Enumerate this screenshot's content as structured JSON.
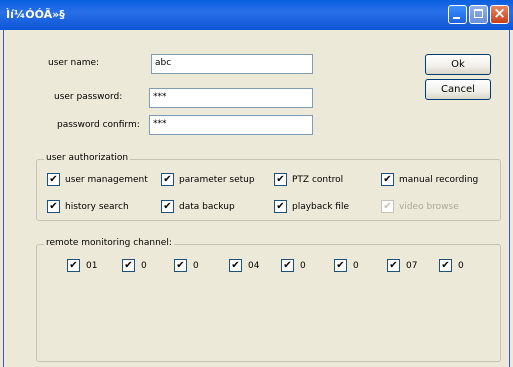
{
  "window": {
    "title": "Ìí¼ÓÓÃ»§"
  },
  "form": {
    "username_label": "user name:",
    "username_value": "abc",
    "password_label": "user password:",
    "password_value": "***",
    "confirm_label": "password confirm:",
    "confirm_value": "***"
  },
  "buttons": {
    "ok": "Ok",
    "cancel": "Cancel"
  },
  "authorization": {
    "title": "user authorization",
    "items": [
      {
        "label": "user management",
        "mark": "✔"
      },
      {
        "label": "parameter setup",
        "mark": "✔"
      },
      {
        "label": "PTZ control",
        "mark": "✔"
      },
      {
        "label": "manual recording",
        "mark": "✔"
      },
      {
        "label": "history search",
        "mark": "✔"
      },
      {
        "label": "data backup",
        "mark": "✔"
      },
      {
        "label": "playback file",
        "mark": "✔"
      },
      {
        "label": "video browse",
        "mark": "✔"
      }
    ]
  },
  "channels": {
    "title": "remote monitoring channel:",
    "items": [
      {
        "label": "01",
        "mark": "✔"
      },
      {
        "label": "0",
        "mark": "✔"
      },
      {
        "label": "0",
        "mark": "✔"
      },
      {
        "label": "04",
        "mark": "✔"
      },
      {
        "label": "0",
        "mark": "✔"
      },
      {
        "label": "0",
        "mark": "✔"
      },
      {
        "label": "07",
        "mark": "✔"
      },
      {
        "label": "0",
        "mark": "✔"
      }
    ]
  }
}
